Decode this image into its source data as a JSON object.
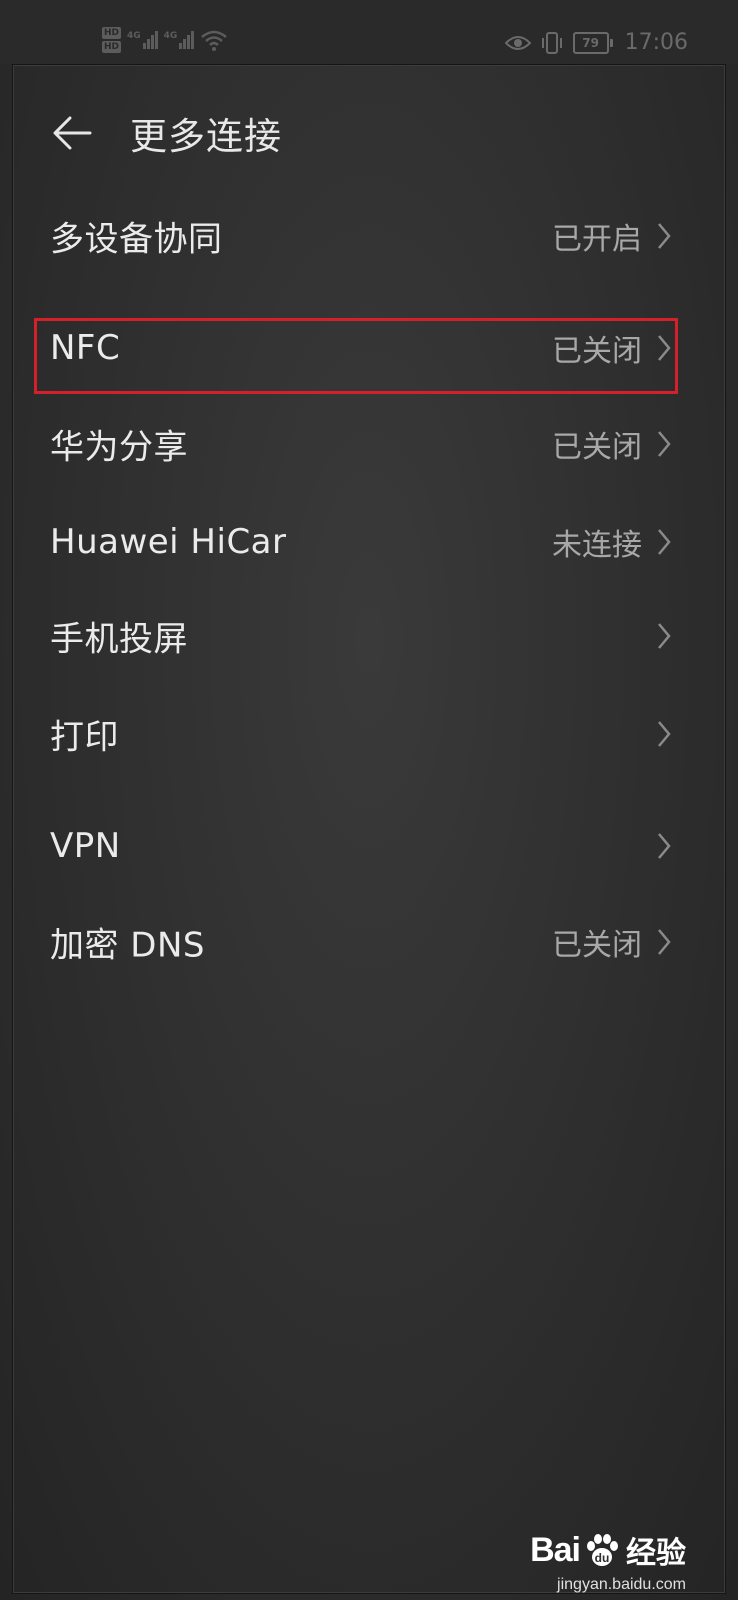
{
  "status_bar": {
    "hd_badges": [
      "HD",
      "HD"
    ],
    "signal_labels": [
      "4G",
      "4G"
    ],
    "battery_level": "79",
    "time": "17:06"
  },
  "header": {
    "title": "更多连接"
  },
  "items": [
    {
      "label": "多设备协同",
      "status": "已开启"
    },
    {
      "label": "NFC",
      "status": "已关闭"
    },
    {
      "label": "华为分享",
      "status": "已关闭"
    },
    {
      "label": "Huawei  HiCar",
      "status": "未连接"
    },
    {
      "label": "手机投屏",
      "status": ""
    },
    {
      "label": "打印",
      "status": ""
    },
    {
      "label": "VPN",
      "status": ""
    },
    {
      "label": "加密  DNS",
      "status": "已关闭"
    }
  ],
  "watermark": {
    "brand_left": "Bai",
    "brand_right": "du",
    "brand_suffix": "经验",
    "url": "jingyan.baidu.com"
  },
  "colors": {
    "highlight": "#d4202a",
    "background": "#2e2e2e",
    "text_primary": "#ebebeb",
    "text_secondary": "#a8a8a8"
  }
}
